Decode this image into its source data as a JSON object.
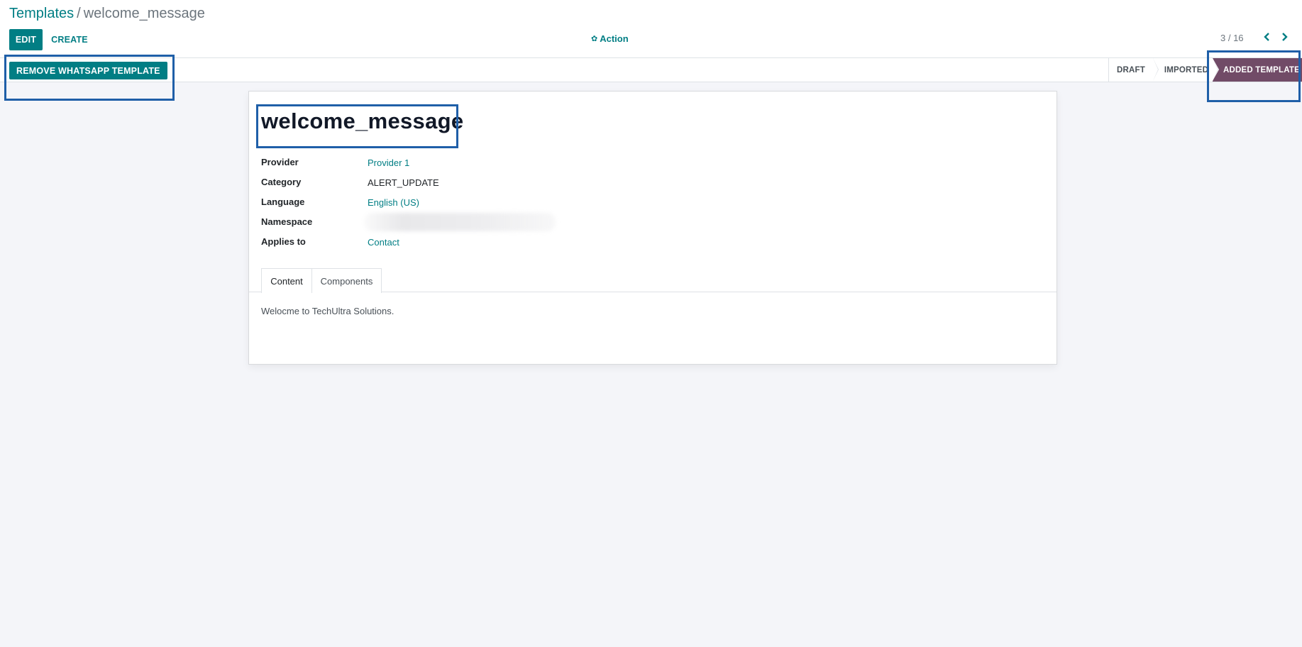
{
  "breadcrumb": {
    "parent": "Templates",
    "separator": "/",
    "current": "welcome_message"
  },
  "toolbar": {
    "edit_label": "EDIT",
    "create_label": "CREATE",
    "action_label": "Action",
    "action_icon": "gear-icon"
  },
  "pager": {
    "value": "3 / 16",
    "prev_icon": "chevron-left-icon",
    "next_icon": "chevron-right-icon"
  },
  "statusbar": {
    "remove_button_label": "REMOVE WHATSAPP TEMPLATE",
    "stages": [
      "DRAFT",
      "IMPORTED",
      "ADDED TEMPLATE"
    ],
    "active_stage": "ADDED TEMPLATE"
  },
  "record": {
    "title": "welcome_message",
    "fields": [
      {
        "label": "Provider",
        "value": "Provider 1"
      },
      {
        "label": "Category",
        "value": "ALERT_UPDATE"
      },
      {
        "label": "Language",
        "value": "English (US)"
      },
      {
        "label": "Namespace",
        "value": ""
      },
      {
        "label": "Applies to",
        "value": "Contact"
      }
    ]
  },
  "tabs": [
    {
      "label": "Content",
      "active": true
    },
    {
      "label": "Components",
      "active": false
    }
  ],
  "content_text": "Welocme to TechUltra Solutions.",
  "colors": {
    "primary": "#017e84",
    "active_stage": "#714b67",
    "highlight_box": "#1f5fa8",
    "background": "#f4f5f9"
  }
}
